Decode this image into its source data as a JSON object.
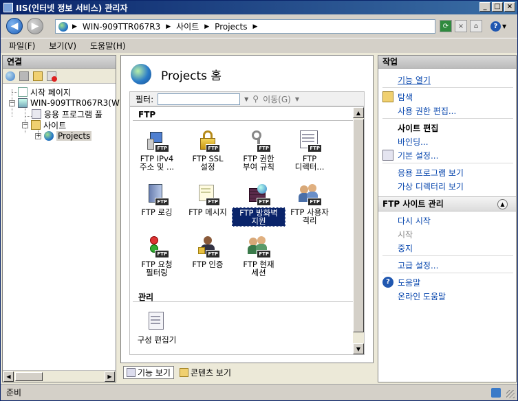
{
  "window": {
    "title": "IIS(인터넷 정보 서비스) 관리자"
  },
  "address": {
    "crumbs": [
      "WIN-909TTR067R3",
      "사이트",
      "Projects"
    ]
  },
  "menu": {
    "file": "파일(F)",
    "view": "보기(V)",
    "help": "도움말(H)"
  },
  "connections": {
    "header": "연결",
    "tree": {
      "start_page": "시작 페이지",
      "server": "WIN-909TTR067R3(W",
      "app_pools": "응용 프로그램 풀",
      "sites": "사이트",
      "projects": "Projects"
    }
  },
  "center": {
    "title": "Projects 홈",
    "filter_label": "필터:",
    "go_label": "이동(G)",
    "sections": {
      "ftp": "FTP",
      "management": "관리"
    },
    "tiles": {
      "ipv4": {
        "line1": "FTP IPv4",
        "line2": "주소 및 ..."
      },
      "ssl": {
        "line1": "FTP SSL",
        "line2": "설정"
      },
      "authz": {
        "line1": "FTP 권한",
        "line2": "부여 규칙"
      },
      "dir": {
        "line1": "FTP",
        "line2": "디렉터..."
      },
      "logging": {
        "line1": "FTP 로깅"
      },
      "messages": {
        "line1": "FTP 메시지"
      },
      "firewall": {
        "line1": "FTP 방화벽",
        "line2": "지원"
      },
      "user_isolation": {
        "line1": "FTP 사용자",
        "line2": "격리"
      },
      "request_filter": {
        "line1": "FTP 요청",
        "line2": "필터링"
      },
      "auth": {
        "line1": "FTP 인증"
      },
      "sessions": {
        "line1": "FTP 현재",
        "line2": "세션"
      },
      "config_editor": {
        "line1": "구성 편집기"
      }
    },
    "view_tabs": {
      "features": "기능 보기",
      "content": "콘텐츠 보기"
    }
  },
  "actions": {
    "header": "작업",
    "open_feature": "기능 열기",
    "explore": "탐색",
    "edit_permissions": "사용 권한 편집...",
    "edit_site_title": "사이트 편집",
    "bindings": "바인딩...",
    "basic_settings": "기본 설정...",
    "view_apps": "응용 프로그램 보기",
    "view_vdirs": "가상 디렉터리 보기",
    "ftp_manage_header": "FTP 사이트 관리",
    "restart": "다시 시작",
    "start": "시작",
    "stop": "중지",
    "advanced": "고급 설정...",
    "help": "도움말",
    "online_help": "온라인 도움말"
  },
  "status": {
    "text": "준비"
  },
  "colors": {
    "selection": "#0a246a",
    "link": "#0645ad"
  }
}
